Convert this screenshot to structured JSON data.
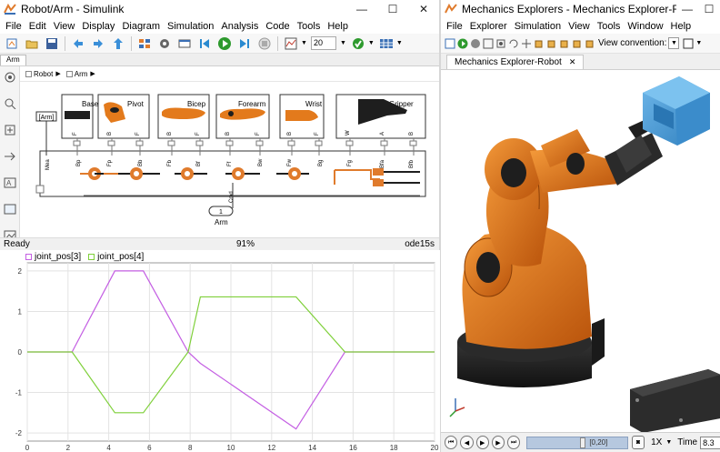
{
  "simulink": {
    "title": "Robot/Arm - Simulink",
    "menu": [
      "File",
      "Edit",
      "View",
      "Display",
      "Diagram",
      "Simulation",
      "Analysis",
      "Code",
      "Tools",
      "Help"
    ],
    "stop_time": "20",
    "tab": "Arm",
    "breadcrumb": [
      "Robot",
      "Arm"
    ],
    "goto_tag": "[Arm]",
    "blocks": [
      {
        "name": "Base",
        "ports": [
          "F"
        ]
      },
      {
        "name": "Pivot",
        "ports": [
          "B",
          "F"
        ]
      },
      {
        "name": "Bicep",
        "ports": [
          "B",
          "F"
        ]
      },
      {
        "name": "Forearm",
        "ports": [
          "B",
          "F"
        ]
      },
      {
        "name": "Wrist",
        "ports": [
          "B",
          "F"
        ]
      },
      {
        "name": "Gripper",
        "ports": [
          "W",
          "A",
          "B"
        ]
      }
    ],
    "bus_labels": [
      "Mea",
      "Bp",
      "Fp",
      "Bb",
      "Fb",
      "Bf",
      "Ff",
      "Bw",
      "Fw",
      "Bg",
      "Fg",
      "Bfa",
      "Bfb",
      "Cmd"
    ],
    "inport_number": "1",
    "inport_label": "Arm",
    "status": {
      "left": "Ready",
      "zoom": "91%",
      "solver": "ode15s"
    }
  },
  "scope": {
    "legend": [
      {
        "label": "joint_pos[3]",
        "color": "#c45fe3"
      },
      {
        "label": "joint_pos[4]",
        "color": "#7fd03a"
      }
    ]
  },
  "chart_data": {
    "type": "line",
    "x": [
      0,
      2.2,
      4.3,
      5.7,
      7.9,
      8.5,
      13.2,
      15.6,
      20
    ],
    "series": [
      {
        "name": "joint_pos[3]",
        "values": [
          0,
          0,
          2,
          2,
          0,
          -0.28,
          -1.9,
          0,
          0
        ]
      },
      {
        "name": "joint_pos[4]",
        "values": [
          0,
          0,
          -1.5,
          -1.5,
          0,
          1.36,
          1.36,
          0,
          0
        ]
      }
    ],
    "xlim": [
      0,
      20
    ],
    "ylim": [
      -2.2,
      2.2
    ],
    "xticks": [
      0,
      2,
      4,
      6,
      8,
      10,
      12,
      14,
      16,
      18,
      20
    ],
    "yticks": [
      2,
      1,
      0,
      -1,
      -2
    ],
    "grid": true,
    "legend": "top-left"
  },
  "mech": {
    "title": "Mechanics Explorers - Mechanics Explorer-Rob...",
    "menu": [
      "File",
      "Explorer",
      "Simulation",
      "View",
      "Tools",
      "Window",
      "Help"
    ],
    "view_convention_label": "View convention:",
    "tab": "Mechanics Explorer-Robot",
    "speed": "1X",
    "time_label": "Time",
    "time_value": "8.3",
    "range": "[0,20]"
  },
  "colors": {
    "robot_orange": "#e37a1c",
    "robot_black": "#1e1e1e",
    "cube_blue": "#4f9fd8",
    "port_orange": "#e07b2c",
    "play_green": "#2e9a2e"
  }
}
